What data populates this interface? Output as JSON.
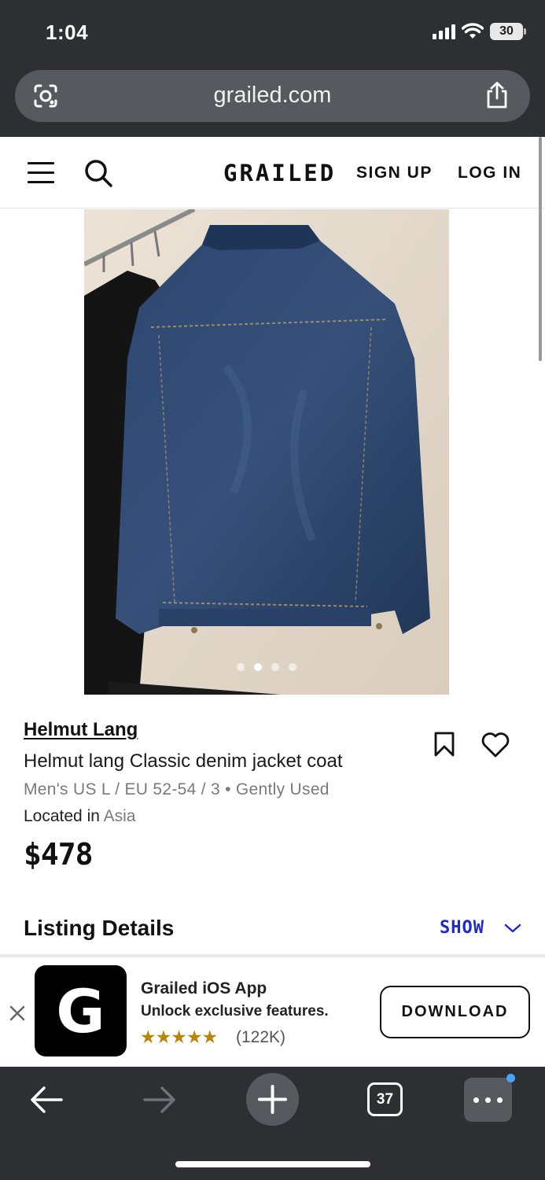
{
  "status_bar": {
    "time": "1:04",
    "battery": "30"
  },
  "browser": {
    "url": "grailed.com",
    "tab_count": "37"
  },
  "header": {
    "logo": "GRAILED",
    "signup": "SIGN UP",
    "login": "LOG IN"
  },
  "listing": {
    "brand": "Helmut Lang",
    "title": "Helmut lang Classic denim jacket coat",
    "size_condition": "Men's US L / EU 52-54 / 3 • Gently Used",
    "location_label": "Located in",
    "location_value": "Asia",
    "price": "$478",
    "image_count": 4,
    "active_image": 2
  },
  "details": {
    "heading": "Listing Details",
    "toggle": "SHOW"
  },
  "app_banner": {
    "icon_letter": "G",
    "name": "Grailed iOS App",
    "tagline": "Unlock exclusive features.",
    "stars": "★★★★★",
    "reviews": "(122K)",
    "cta": "DOWNLOAD"
  },
  "colors": {
    "accent_link": "#1e2bc8",
    "star_gold": "#b8860b",
    "chrome": "#2d2f33"
  }
}
